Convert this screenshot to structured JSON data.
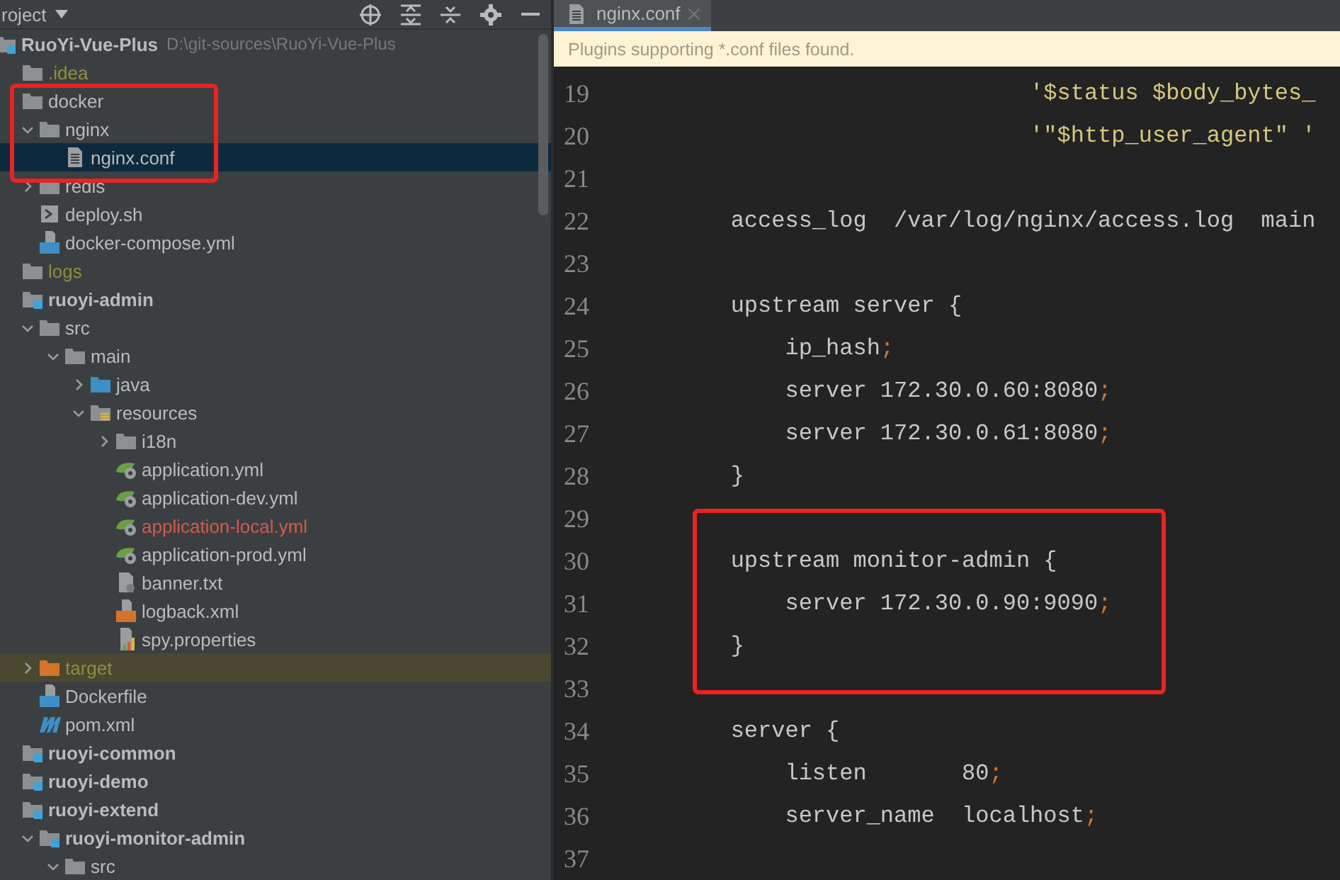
{
  "project_panel": {
    "title": "roject",
    "root": {
      "name": "RuoYi-Vue-Plus",
      "path": "D:\\git-sources\\RuoYi-Vue-Plus",
      "children": [
        {
          "name": ".idea",
          "kind": "folder",
          "color": "#8f8f3e",
          "selected": false
        },
        {
          "name": "docker",
          "kind": "folder",
          "color": "#bbbbbb",
          "selected": false,
          "children": [
            {
              "name": "nginx",
              "kind": "folder",
              "color": "#bbbbbb",
              "expanded": true,
              "selected": false,
              "children": [
                {
                  "name": "nginx.conf",
                  "kind": "text-file",
                  "color": "#bbbbbb",
                  "selected": true
                }
              ]
            },
            {
              "name": "redis",
              "kind": "folder",
              "color": "#bbbbbb",
              "expanded": false,
              "selected": false
            },
            {
              "name": "deploy.sh",
              "kind": "shell-file",
              "color": "#bbbbbb",
              "selected": false
            },
            {
              "name": "docker-compose.yml",
              "kind": "compose-file",
              "color": "#bbbbbb",
              "selected": false
            }
          ]
        },
        {
          "name": "logs",
          "kind": "folder",
          "color": "#8f8f3e",
          "selected": false
        },
        {
          "name": "ruoyi-admin",
          "kind": "module",
          "color": "#bbbbbb",
          "selected": false,
          "children": [
            {
              "name": "src",
              "kind": "folder",
              "color": "#bbbbbb",
              "expanded": true,
              "selected": false,
              "children": [
                {
                  "name": "main",
                  "kind": "folder",
                  "color": "#bbbbbb",
                  "expanded": true,
                  "selected": false,
                  "children": [
                    {
                      "name": "java",
                      "kind": "source-folder",
                      "color": "#bbbbbb",
                      "expanded": false,
                      "selected": false
                    },
                    {
                      "name": "resources",
                      "kind": "resources-folder",
                      "color": "#bbbbbb",
                      "expanded": true,
                      "selected": false,
                      "children": [
                        {
                          "name": "i18n",
                          "kind": "folder",
                          "color": "#bbbbbb",
                          "expanded": false,
                          "selected": false
                        },
                        {
                          "name": "application.yml",
                          "kind": "spring-file",
                          "color": "#bbbbbb",
                          "selected": false
                        },
                        {
                          "name": "application-dev.yml",
                          "kind": "spring-file",
                          "color": "#bbbbbb",
                          "selected": false
                        },
                        {
                          "name": "application-local.yml",
                          "kind": "spring-file",
                          "color": "#d25a4d",
                          "selected": false
                        },
                        {
                          "name": "application-prod.yml",
                          "kind": "spring-file",
                          "color": "#bbbbbb",
                          "selected": false
                        },
                        {
                          "name": "banner.txt",
                          "kind": "plain-file",
                          "color": "#bbbbbb",
                          "selected": false
                        },
                        {
                          "name": "logback.xml",
                          "kind": "xml-file",
                          "color": "#bbbbbb",
                          "selected": false
                        },
                        {
                          "name": "spy.properties",
                          "kind": "properties-file",
                          "color": "#bbbbbb",
                          "selected": false
                        }
                      ]
                    }
                  ]
                }
              ]
            },
            {
              "name": "target",
              "kind": "excluded-folder",
              "color": "#8f8f3e",
              "expanded": false,
              "selected": false
            },
            {
              "name": "Dockerfile",
              "kind": "docker-file",
              "color": "#bbbbbb",
              "selected": false
            },
            {
              "name": "pom.xml",
              "kind": "maven-file",
              "color": "#bbbbbb",
              "selected": false
            }
          ]
        },
        {
          "name": "ruoyi-common",
          "kind": "module",
          "color": "#bbbbbb",
          "selected": false
        },
        {
          "name": "ruoyi-demo",
          "kind": "module",
          "color": "#bbbbbb",
          "selected": false
        },
        {
          "name": "ruoyi-extend",
          "kind": "module",
          "color": "#bbbbbb",
          "selected": false,
          "children": [
            {
              "name": "ruoyi-monitor-admin",
              "kind": "module",
              "color": "#bbbbbb",
              "expanded": true,
              "selected": false,
              "children": [
                {
                  "name": "src",
                  "kind": "folder",
                  "color": "#bbbbbb",
                  "expanded": true,
                  "selected": false
                }
              ]
            }
          ]
        }
      ]
    }
  },
  "editor": {
    "tabs": [
      {
        "label": "nginx.conf",
        "selected": true
      }
    ],
    "notification": "Plugins supporting *.conf files found.",
    "lines": [
      {
        "number": "19",
        "kind": "string",
        "text": "                              '$status $body_bytes_"
      },
      {
        "number": "20",
        "kind": "string",
        "text": "                              '\"$http_user_agent\" '"
      },
      {
        "number": "21"
      },
      {
        "number": "22",
        "kind": "plain",
        "text": "        access_log  /var/log/nginx/access.log  main"
      },
      {
        "number": "23"
      },
      {
        "number": "24",
        "kind": "plain",
        "text": "        upstream server {"
      },
      {
        "number": "25",
        "kind": "plain",
        "text": "            ip_hash;"
      },
      {
        "number": "26",
        "kind": "plain",
        "text": "            server 172.30.0.60:8080;"
      },
      {
        "number": "27",
        "kind": "plain",
        "text": "            server 172.30.0.61:8080;"
      },
      {
        "number": "28",
        "kind": "plain",
        "text": "        }"
      },
      {
        "number": "29"
      },
      {
        "number": "30",
        "kind": "plain",
        "text": "        upstream monitor-admin {"
      },
      {
        "number": "31",
        "kind": "plain",
        "text": "            server 172.30.0.90:9090;"
      },
      {
        "number": "32",
        "kind": "plain",
        "text": "        }"
      },
      {
        "number": "33"
      },
      {
        "number": "34",
        "kind": "plain",
        "text": "        server {"
      },
      {
        "number": "35",
        "kind": "plain",
        "text": "            listen       80;"
      },
      {
        "number": "36",
        "kind": "plain",
        "text": "            server_name  localhost;"
      },
      {
        "number": "37"
      }
    ]
  }
}
